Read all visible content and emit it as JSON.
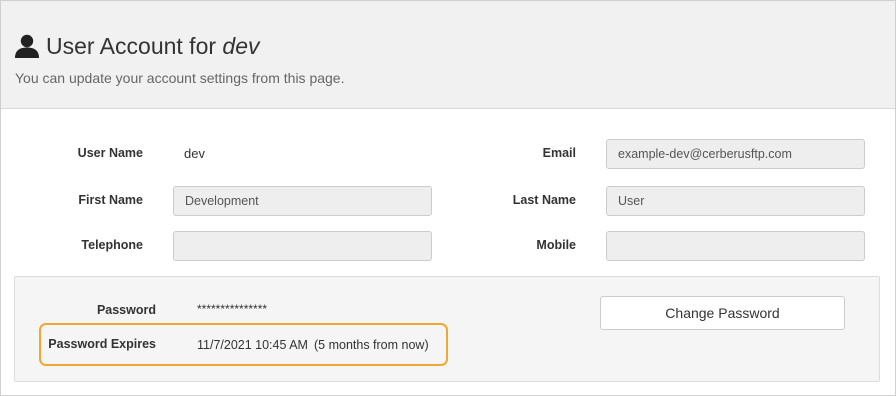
{
  "header": {
    "title_prefix": "User Account for ",
    "title_user": "dev",
    "subtitle": "You can update your account settings from this page.",
    "icon": "user-icon"
  },
  "form": {
    "username_label": "User Name",
    "username_value": "dev",
    "email_label": "Email",
    "email_value": "example-dev@cerberusftp.com",
    "firstname_label": "First Name",
    "firstname_value": "Development",
    "lastname_label": "Last Name",
    "lastname_value": "User",
    "telephone_label": "Telephone",
    "telephone_value": "",
    "mobile_label": "Mobile",
    "mobile_value": ""
  },
  "password": {
    "label": "Password",
    "value": "***************",
    "expires_label": "Password Expires",
    "expires_value": "11/7/2021 10:45 AM",
    "expires_relative": "(5 months from now)",
    "change_button": "Change Password"
  },
  "colors": {
    "highlight": "#f0a830",
    "header_bg": "#f1f1f1"
  }
}
